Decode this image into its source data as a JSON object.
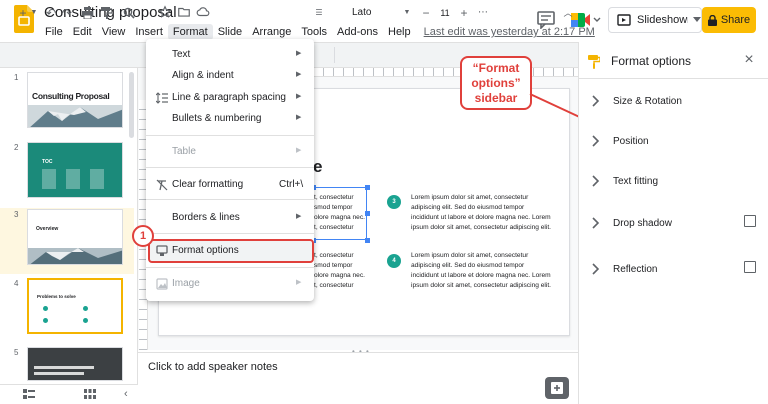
{
  "app": {
    "title": "Consulting proposal",
    "last_edit": "Last edit was yesterday at 2:17 PM",
    "menus": [
      "File",
      "Edit",
      "View",
      "Insert",
      "Format",
      "Slide",
      "Arrange",
      "Tools",
      "Add-ons",
      "Help"
    ],
    "active_menu": "Format",
    "slideshow_label": "Slideshow",
    "share_label": "Share",
    "accent_color": "#fbbc04"
  },
  "toolbar": {
    "font_name": "Lato",
    "font_size": "11",
    "zoom_symbol": "−"
  },
  "filmstrip": {
    "slides": [
      {
        "number": "1",
        "title": "Consulting Proposal"
      },
      {
        "number": "2",
        "title": "TOC"
      },
      {
        "number": "3",
        "title": "Overview"
      },
      {
        "number": "4",
        "title": "Problems to solve"
      },
      {
        "number": "5",
        "title": ""
      }
    ],
    "selected": 4
  },
  "slide": {
    "title_fragment": "e",
    "text_blocks": [
      "Lorem ipsum dolor sit amet, consectetur adipiscing elit. Sed do eiusmod tempor incididunt ut labore et dolore magna nec. Lorem ipsum dolor sit amet, consectetur",
      "Lorem ipsum dolor sit amet, consectetur adipiscing elit. Sed do eiusmod tempor incididunt ut labore et dolore magna nec. Lorem ipsum dolor sit amet, consectetur adipiscing elit.",
      "Lorem ipsum dolor sit amet, consectetur adipiscing elit. Sed do eiusmod tempor incididunt ut labore et dolore magna nec. Lorem ipsum dolor sit amet, consectetur",
      "Lorem ipsum dolor sit amet, consectetur adipiscing elit. Sed do eiusmod tempor incididunt ut labore et dolore magna nec. Lorem ipsum dolor sit amet, consectetur adipiscing elit."
    ],
    "numbers": [
      "3",
      "4"
    ],
    "left_fragments": [
      "t, consectetur",
      "smod tempor",
      "olore magna nec.",
      "t, consectetur",
      "t, consectetur",
      "smod tempor",
      "olore magna nec.",
      "t, consectetur"
    ],
    "speaker_notes_placeholder": "Click to add speaker notes"
  },
  "format_menu": {
    "items": [
      {
        "label": "Text",
        "submenu": true
      },
      {
        "label": "Align & indent",
        "submenu": true
      },
      {
        "label": "Line & paragraph spacing",
        "submenu": true
      },
      {
        "label": "Bullets & numbering",
        "submenu": true
      },
      {
        "label": "Table",
        "submenu": true,
        "disabled": true
      },
      {
        "label": "Clear formatting",
        "shortcut": "Ctrl+\\"
      },
      {
        "label": "Borders & lines",
        "submenu": true
      },
      {
        "label": "Format options"
      },
      {
        "label": "Image",
        "submenu": true,
        "disabled": true
      }
    ],
    "step_badge": "1"
  },
  "annotation": {
    "lines": [
      "“Format",
      "options”",
      "sidebar"
    ],
    "color": "#e0403b"
  },
  "sidebar": {
    "title": "Format options",
    "sections": [
      {
        "label": "Size & Rotation",
        "checkbox": false
      },
      {
        "label": "Position",
        "checkbox": false
      },
      {
        "label": "Text fitting",
        "checkbox": false
      },
      {
        "label": "Drop shadow",
        "checkbox": true
      },
      {
        "label": "Reflection",
        "checkbox": true
      }
    ]
  }
}
